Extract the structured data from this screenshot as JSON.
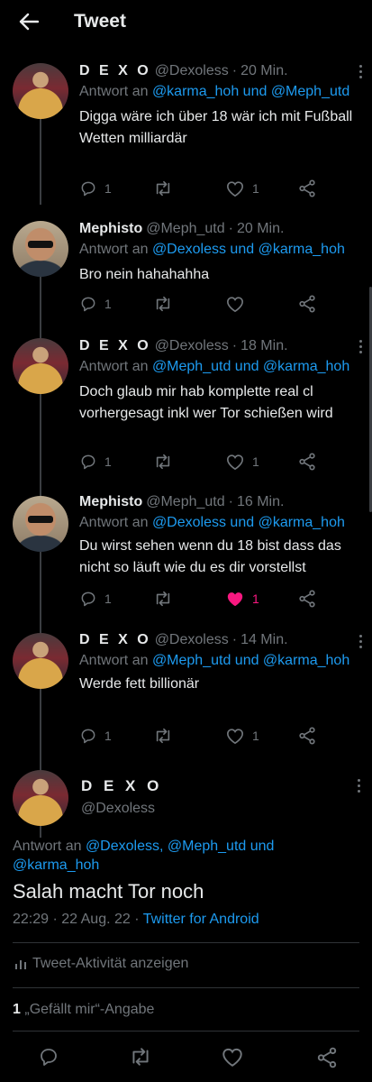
{
  "header": {
    "title": "Tweet"
  },
  "colors": {
    "link": "#1d9bf0",
    "muted": "#71767b",
    "like": "#f91880",
    "background": "#000000"
  },
  "thread": [
    {
      "name": "D E X O",
      "handle": "@Dexoless",
      "time": "20 Min.",
      "reply_prefix": "Antwort an",
      "reply_links": "@karma_hoh und @Meph_utd",
      "text": "Digga wäre ich über 18 wär ich mit Fußball Wetten milliardär",
      "reply_count": "1",
      "like_count": "1",
      "liked": false
    },
    {
      "name": "Mephisto",
      "handle": "@Meph_utd",
      "time": "20 Min.",
      "reply_prefix": "Antwort an",
      "reply_links": "@Dexoless und @karma_hoh",
      "text": "Bro nein hahahahha",
      "reply_count": "1",
      "like_count": "",
      "liked": false
    },
    {
      "name": "D E X O",
      "handle": "@Dexoless",
      "time": "18 Min.",
      "reply_prefix": "Antwort an",
      "reply_links": "@Meph_utd und @karma_hoh",
      "text": "Doch glaub mir hab komplette real cl vorhergesagt inkl wer Tor schießen wird",
      "reply_count": "1",
      "like_count": "1",
      "liked": false
    },
    {
      "name": "Mephisto",
      "handle": "@Meph_utd",
      "time": "16 Min.",
      "reply_prefix": "Antwort an",
      "reply_links": "@Dexoless und @karma_hoh",
      "text": "Du wirst sehen wenn du 18 bist dass das nicht so läuft wie du es dir vorstellst",
      "reply_count": "1",
      "like_count": "1",
      "liked": true
    },
    {
      "name": "D E X O",
      "handle": "@Dexoless",
      "time": "14 Min.",
      "reply_prefix": "Antwort an",
      "reply_links": "@Meph_utd und @karma_hoh",
      "text": "Werde fett billionär",
      "reply_count": "1",
      "like_count": "1",
      "liked": false
    }
  ],
  "main_tweet": {
    "name": "D E X O",
    "handle": "@Dexoless",
    "reply_prefix": "Antwort an",
    "reply_links": "@Dexoless, @Meph_utd und @karma_hoh",
    "text": "Salah macht Tor noch",
    "timestamp": "22:29 · 22 Aug. 22 ·",
    "source": "Twitter for Android",
    "activity_label": "Tweet-Aktivität anzeigen",
    "likes_count": "1",
    "likes_label": "„Gefällt mir“-Angabe"
  },
  "icons": [
    "back-arrow-icon",
    "more-icon",
    "reply-icon",
    "retweet-icon",
    "like-icon",
    "share-icon",
    "activity-icon"
  ]
}
